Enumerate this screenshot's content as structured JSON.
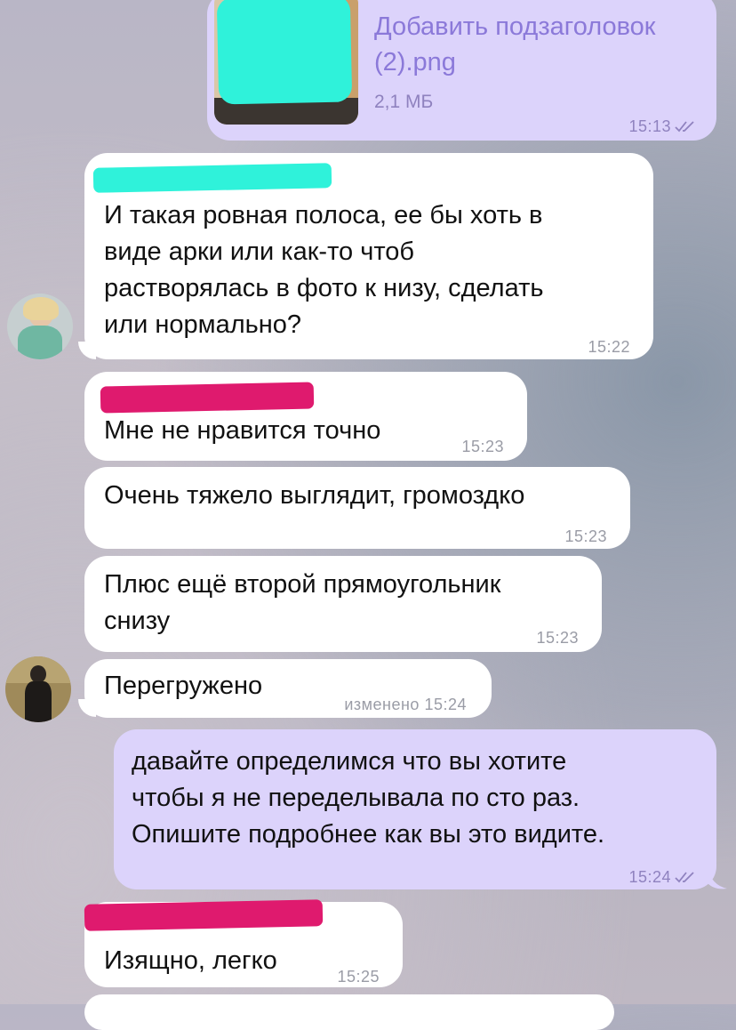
{
  "colors": {
    "incoming_bubble": "#ffffff",
    "outgoing_bubble": "#dcd3fb",
    "file_link": "#8b79d9",
    "redaction_teal": "#2ff2da",
    "redaction_pink": "#df1a6e"
  },
  "messages": [
    {
      "direction": "outgoing",
      "type": "file",
      "file_name": "Добавить подзаголовок\n(2).png",
      "file_size": "2,1 МБ",
      "time": "15:13",
      "read_icon": "double-check-icon"
    },
    {
      "direction": "incoming",
      "sender": "redacted",
      "text": "И такая ровная полоса, ее бы хоть в\nвиде арки или как-то чтоб\nрастворялась в фото к низу,  сделать\nили нормально?",
      "time": "15:22"
    },
    {
      "direction": "incoming",
      "sender": "redacted",
      "text": "Мне не нравится точно",
      "time": "15:23"
    },
    {
      "direction": "incoming",
      "text": "Очень тяжело выглядит, громоздко",
      "time": "15:23"
    },
    {
      "direction": "incoming",
      "text": "Плюс ещё второй прямоугольник\nснизу",
      "time": "15:23"
    },
    {
      "direction": "incoming",
      "text": "Перегружено",
      "edited_label": "изменено",
      "time": "15:24"
    },
    {
      "direction": "outgoing",
      "text": "давайте определимся что вы хотите\nчтобы я не переделывала по сто раз.\nОпишите подробнее как вы это видите.",
      "time": "15:24",
      "read_icon": "double-check-icon"
    },
    {
      "direction": "incoming",
      "sender": "redacted",
      "text": "Изящно, легко",
      "time": "15:25"
    }
  ]
}
